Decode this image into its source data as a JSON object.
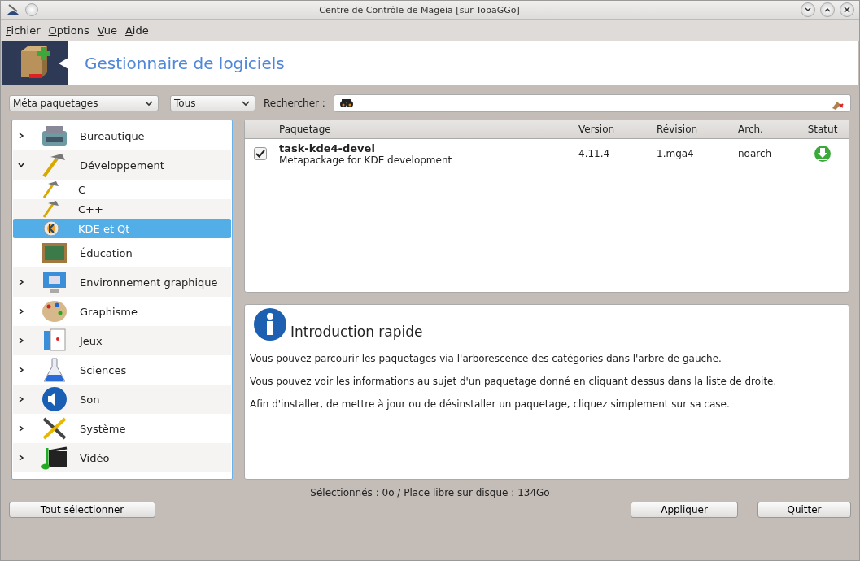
{
  "window": {
    "title": "Centre de Contrôle de Mageia  [sur TobaGGo]"
  },
  "menu": [
    "Fichier",
    "Options",
    "Vue",
    "Aide"
  ],
  "banner": {
    "title": "Gestionnaire de logiciels"
  },
  "filters": {
    "type": "Méta paquetages",
    "state": "Tous",
    "search_label": "Rechercher :"
  },
  "tree": [
    {
      "label": "Bureautique",
      "expandable": true,
      "expanded": false,
      "selected": false
    },
    {
      "label": "Développement",
      "expandable": true,
      "expanded": true,
      "selected": false,
      "children": [
        {
          "label": "C",
          "selected": false
        },
        {
          "label": "C++",
          "selected": false
        },
        {
          "label": "KDE et Qt",
          "selected": true
        }
      ]
    },
    {
      "label": "Éducation",
      "expandable": false,
      "expanded": false,
      "selected": false
    },
    {
      "label": "Environnement graphique",
      "expandable": true,
      "expanded": false,
      "selected": false
    },
    {
      "label": "Graphisme",
      "expandable": true,
      "expanded": false,
      "selected": false
    },
    {
      "label": "Jeux",
      "expandable": true,
      "expanded": false,
      "selected": false
    },
    {
      "label": "Sciences",
      "expandable": true,
      "expanded": false,
      "selected": false
    },
    {
      "label": "Son",
      "expandable": true,
      "expanded": false,
      "selected": false
    },
    {
      "label": "Système",
      "expandable": true,
      "expanded": false,
      "selected": false
    },
    {
      "label": "Vidéo",
      "expandable": true,
      "expanded": false,
      "selected": false
    }
  ],
  "table": {
    "columns": [
      "Paquetage",
      "Version",
      "Révision",
      "Arch.",
      "Statut"
    ],
    "rows": [
      {
        "checked": true,
        "name": "task-kde4-devel",
        "summary": "Metapackage for KDE development",
        "version": "4.11.4",
        "revision": "1.mga4",
        "arch": "noarch"
      }
    ]
  },
  "info": {
    "title": "Introduction rapide",
    "paragraphs": [
      "Vous pouvez parcourir les paquetages via l'arborescence des catégories dans l'arbre de gauche.",
      "Vous pouvez voir les informations au sujet d'un paquetage donné en cliquant dessus dans la liste de droite.",
      "Afin d'installer, de mettre à jour ou de désinstaller un paquetage, cliquez simplement sur sa case."
    ]
  },
  "status_bar": "Sélectionnés : 0o / Place libre sur disque : 134Go",
  "buttons": {
    "select_all": "Tout sélectionner",
    "apply": "Appliquer",
    "quit": "Quitter"
  }
}
